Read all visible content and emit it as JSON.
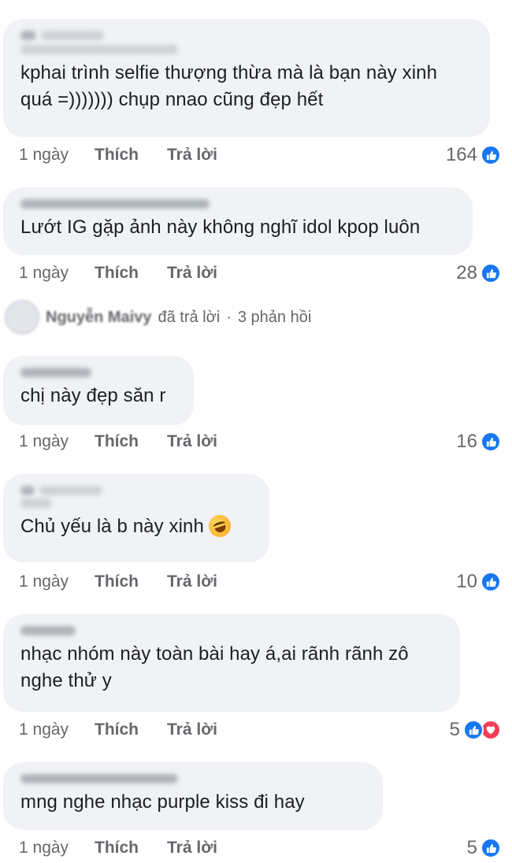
{
  "comments": [
    {
      "text": "kphai trình selfie thượng thừa mà là bạn này xinh\nquá =))))))) chụp nnao cũng đẹp hết",
      "time": "1 ngày",
      "like": "Thích",
      "reply": "Trả lời",
      "count": "164",
      "reactions": [
        "like-icon"
      ]
    },
    {
      "text": "Lướt IG gặp ảnh này không nghĩ idol kpop luôn",
      "time": "1 ngày",
      "like": "Thích",
      "reply": "Trả lời",
      "count": "28",
      "reactions": [
        "like-icon"
      ]
    },
    {
      "text": "chị này đẹp săn r",
      "time": "1 ngày",
      "like": "Thích",
      "reply": "Trả lời",
      "count": "16",
      "reactions": [
        "like-icon"
      ]
    },
    {
      "text": "Chủ yếu là b này xinh",
      "time": "1 ngày",
      "like": "Thích",
      "reply": "Trả lời",
      "count": "10",
      "reactions": [
        "like-icon"
      ],
      "emoji": "rolling-on-floor-laughing-emoji"
    },
    {
      "text": "nhạc nhóm này toàn bài hay á,ai rãnh rãnh zô\nnghe thử y",
      "time": "1 ngày",
      "like": "Thích",
      "reply": "Trả lời",
      "count": "5",
      "reactions": [
        "like-icon",
        "heart-icon"
      ]
    },
    {
      "text": "mng nghe nhạc purple kiss đi hay",
      "time": "1 ngày",
      "like": "Thích",
      "reply": "Trả lời",
      "count": "5",
      "reactions": [
        "like-icon"
      ]
    }
  ],
  "replies_row": {
    "name": "Nguyễn Maivy",
    "action": "đã trả lời",
    "separator": "·",
    "count_text": "3 phản hồi"
  },
  "colors": {
    "bubble": "#f0f2f5",
    "meta": "#65676b",
    "like": "#1877f2",
    "heart": "#f33e58"
  }
}
